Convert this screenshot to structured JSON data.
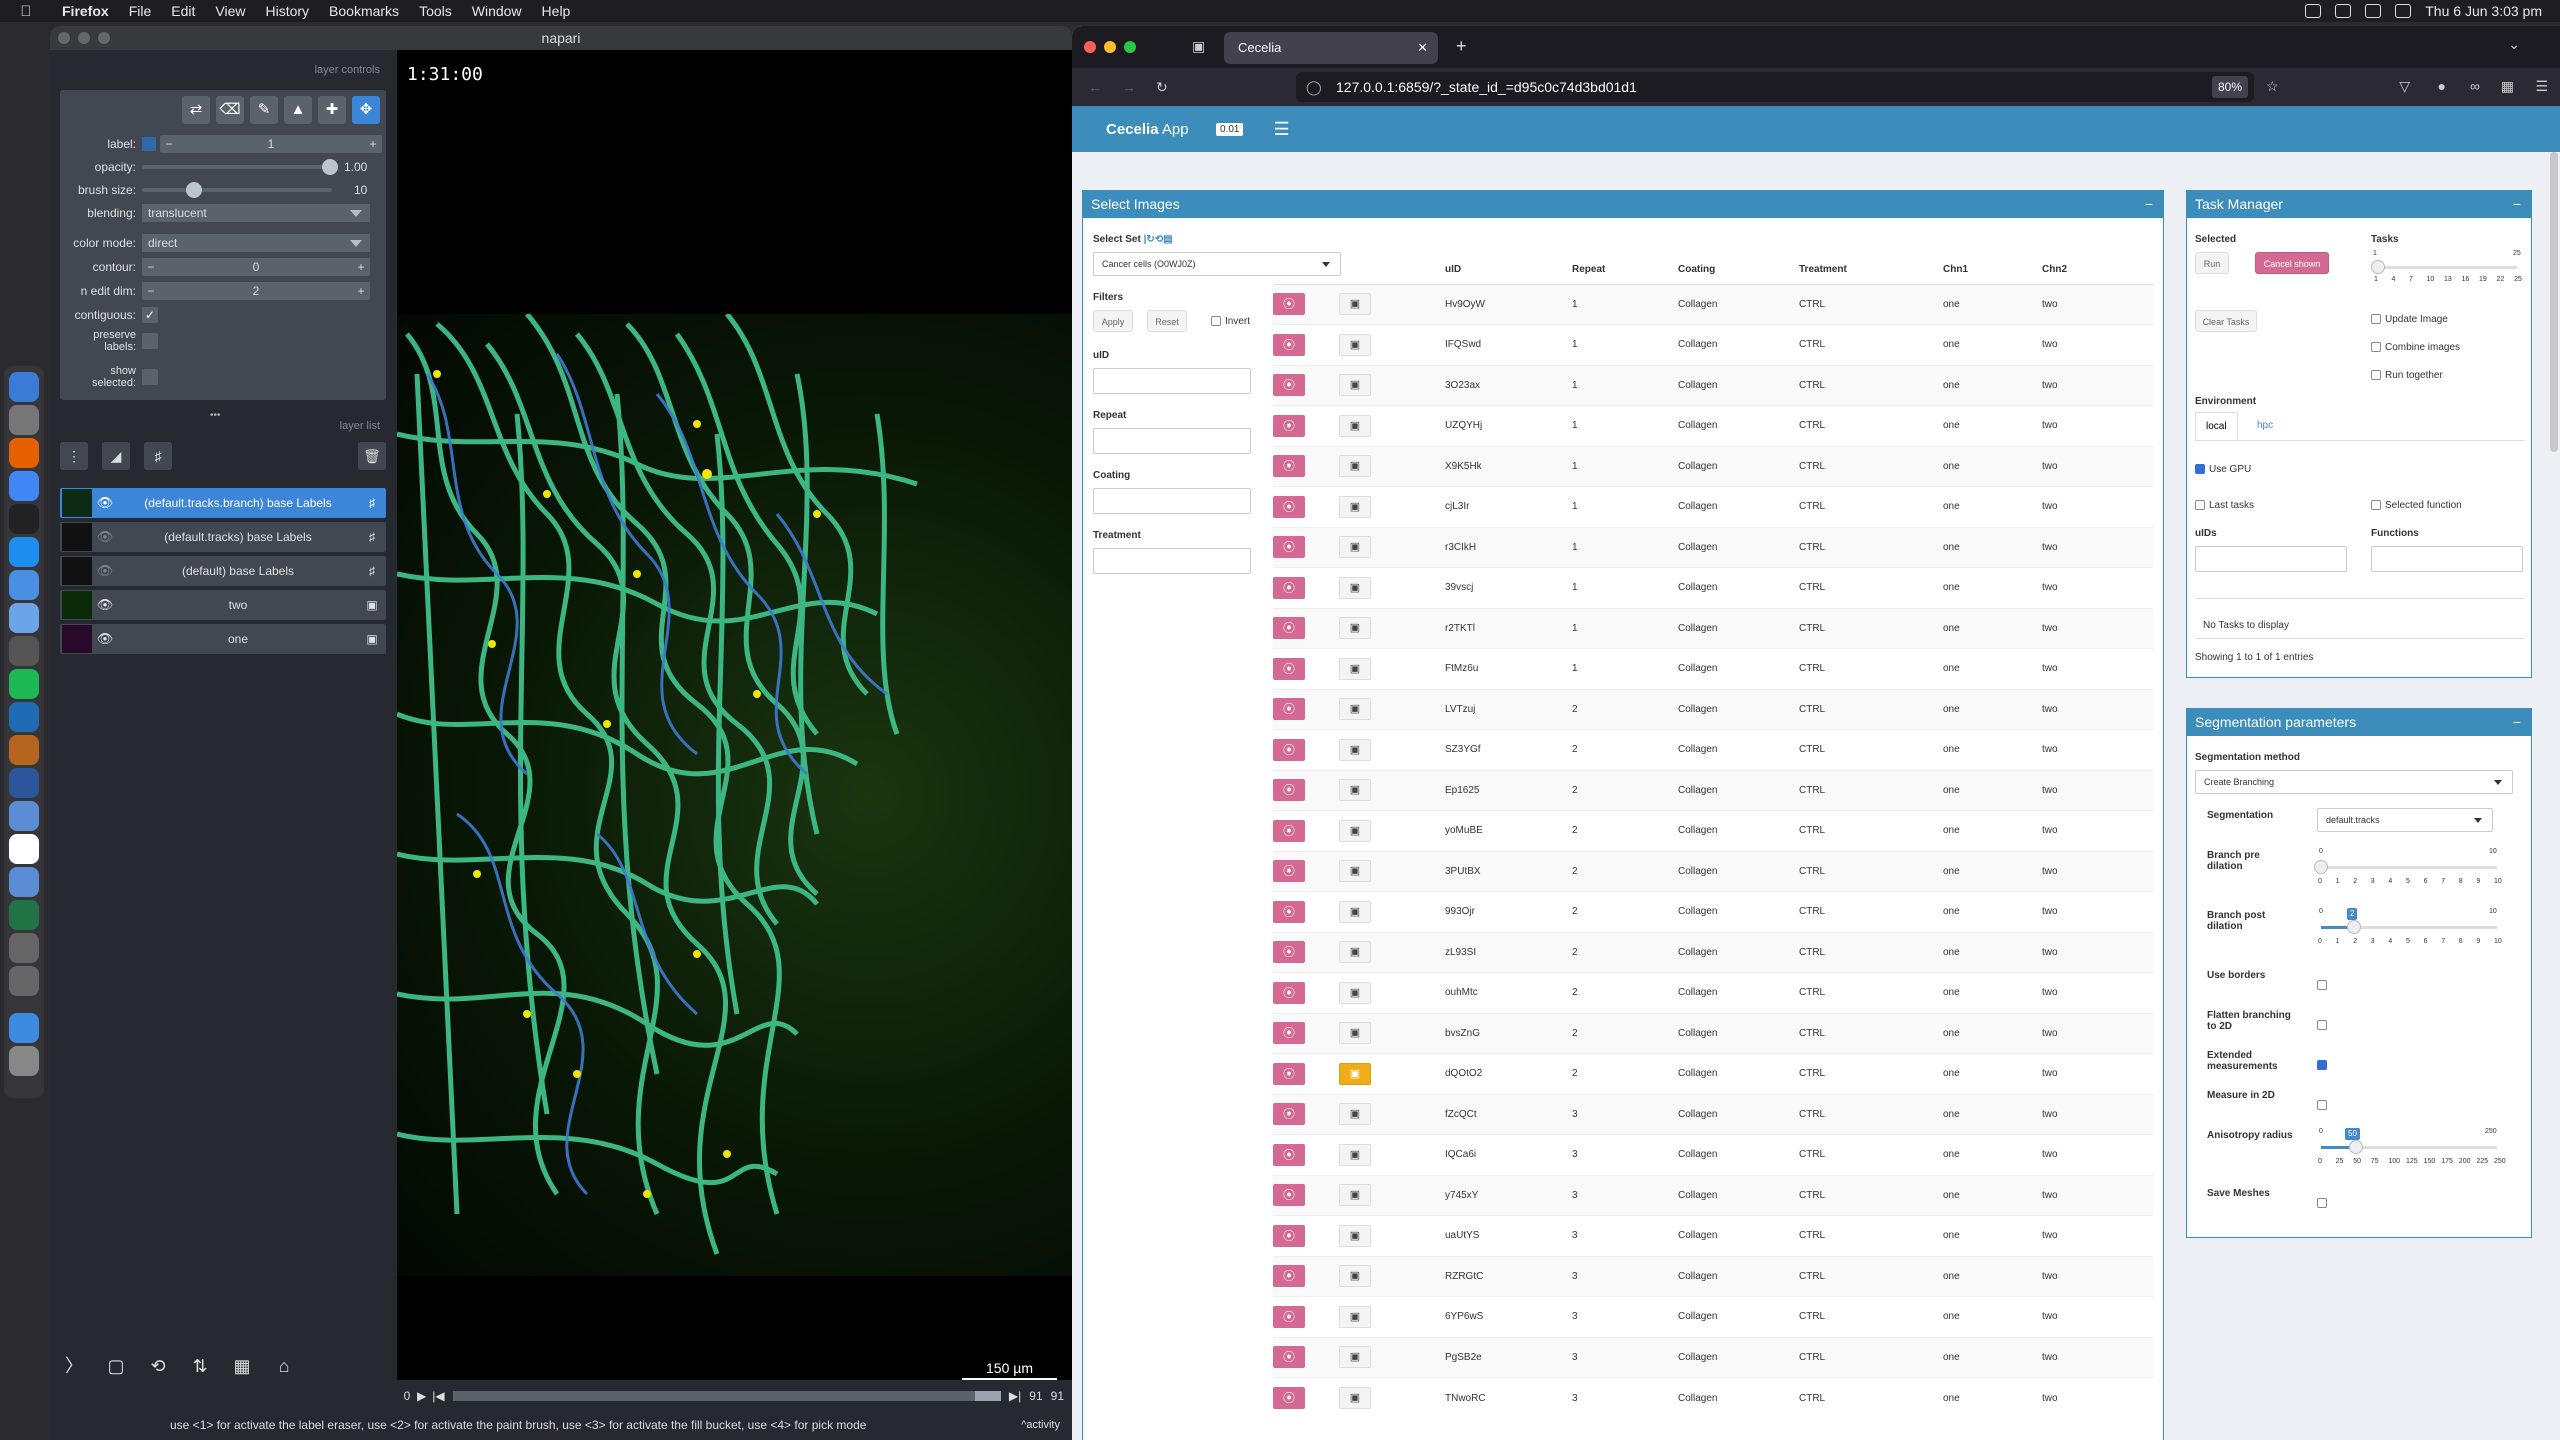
{
  "menubar": {
    "app": "Firefox",
    "items": [
      "File",
      "Edit",
      "View",
      "History",
      "Bookmarks",
      "Tools",
      "Window",
      "Help"
    ],
    "datetime": "Thu 6 Jun  3:03 pm"
  },
  "napari": {
    "title": "napari",
    "layer_controls_title": "layer controls",
    "controls": {
      "label": "label:",
      "label_value": "1",
      "opacity": "opacity:",
      "opacity_value": "1.00",
      "opacity_level": 1.0,
      "brush": "brush size:",
      "brush_value": "10",
      "brush_level": 0.1,
      "blending": "blending:",
      "blending_value": "translucent",
      "color_mode": "color mode:",
      "color_mode_value": "direct",
      "contour": "contour:",
      "contour_value": "0",
      "n_edit": "n edit dim:",
      "n_edit_value": "2",
      "contiguous": "contiguous:",
      "preserve": "preserve labels:",
      "show_selected": "show selected:"
    },
    "layer_list_title": "layer list",
    "layers": [
      {
        "name": "(default.tracks.branch) base Labels",
        "selected": true,
        "type": "labels"
      },
      {
        "name": "(default.tracks) base Labels",
        "selected": false,
        "type": "labels"
      },
      {
        "name": "(default) base Labels",
        "selected": false,
        "type": "labels"
      },
      {
        "name": "two",
        "selected": false,
        "type": "image"
      },
      {
        "name": "one",
        "selected": false,
        "type": "image"
      }
    ],
    "time": "1:31:00",
    "scale": "150 µm",
    "dims": {
      "start": "0",
      "current": "91",
      "max": "91"
    },
    "status": "use <1> for activate the label eraser, use <2> for activate the paint brush, use <3> for activate the fill bucket, use <4> for pick mode",
    "activity": "activity"
  },
  "firefox": {
    "tab_title": "Cecelia",
    "url": "127.0.0.1:6859/?_state_id_=d95c0c74d3bd01d1",
    "zoom": "80%"
  },
  "app": {
    "brand": "Cecelia",
    "brand_suffix": "App",
    "version": "0.01",
    "select_images": {
      "title": "Select Images",
      "select_set_label": "Select Set",
      "set_value": "Cancer cells (O0WJ0Z)",
      "filters": "Filters",
      "apply": "Apply",
      "reset": "Reset",
      "invert": "Invert",
      "filter_fields": [
        "uID",
        "Repeat",
        "Coating",
        "Treatment"
      ],
      "columns": [
        "",
        "",
        "uID",
        "Repeat",
        "Coating",
        "Treatment",
        "Chn1",
        "Chn2"
      ],
      "rows": [
        {
          "uid": "Hv9OyW",
          "repeat": "1"
        },
        {
          "uid": "IFQSwd",
          "repeat": "1"
        },
        {
          "uid": "3O23ax",
          "repeat": "1"
        },
        {
          "uid": "UZQYHj",
          "repeat": "1"
        },
        {
          "uid": "X9K5Hk",
          "repeat": "1"
        },
        {
          "uid": "cjL3Ir",
          "repeat": "1"
        },
        {
          "uid": "r3CIkH",
          "repeat": "1"
        },
        {
          "uid": "39vscj",
          "repeat": "1"
        },
        {
          "uid": "r2TKTl",
          "repeat": "1"
        },
        {
          "uid": "FtMz6u",
          "repeat": "1"
        },
        {
          "uid": "LVTzuj",
          "repeat": "2"
        },
        {
          "uid": "SZ3YGf",
          "repeat": "2"
        },
        {
          "uid": "Ep1625",
          "repeat": "2"
        },
        {
          "uid": "yoMuBE",
          "repeat": "2"
        },
        {
          "uid": "3PUtBX",
          "repeat": "2"
        },
        {
          "uid": "993Ojr",
          "repeat": "2"
        },
        {
          "uid": "zL93SI",
          "repeat": "2"
        },
        {
          "uid": "ouhMtc",
          "repeat": "2"
        },
        {
          "uid": "bvsZnG",
          "repeat": "2"
        },
        {
          "uid": "dQOtO2",
          "repeat": "2",
          "active": true
        },
        {
          "uid": "fZcQCt",
          "repeat": "3"
        },
        {
          "uid": "IQCa6i",
          "repeat": "3"
        },
        {
          "uid": "y745xY",
          "repeat": "3"
        },
        {
          "uid": "uaUtYS",
          "repeat": "3"
        },
        {
          "uid": "RZRGtC",
          "repeat": "3"
        },
        {
          "uid": "6YP6wS",
          "repeat": "3"
        },
        {
          "uid": "PgSB2e",
          "repeat": "3"
        },
        {
          "uid": "TNwoRC",
          "repeat": "3"
        }
      ],
      "coating": "Collagen",
      "treatment": "CTRL",
      "chn1": "one",
      "chn2": "two"
    },
    "task_manager": {
      "title": "Task Manager",
      "selected": "Selected",
      "run": "Run",
      "cancel": "Cancel shown",
      "tasks": "Tasks",
      "tasks_min": "1",
      "tasks_max": "25",
      "tasks_ticks": [
        "1",
        "4",
        "7",
        "10",
        "13",
        "16",
        "19",
        "22",
        "25"
      ],
      "clear": "Clear Tasks",
      "update_image": "Update Image",
      "combine": "Combine images",
      "run_together": "Run together",
      "environment": "Environment",
      "env_tabs": [
        "local",
        "hpc"
      ],
      "use_gpu": "Use GPU",
      "last_tasks": "Last tasks",
      "selected_function": "Selected function",
      "uids": "uIDs",
      "functions": "Functions",
      "no_tasks": "No Tasks to display",
      "showing": "Showing 1 to 1 of 1 entries"
    },
    "segmentation": {
      "title": "Segmentation parameters",
      "method_label": "Segmentation method",
      "method_value": "Create Branching",
      "seg_label": "Segmentation",
      "seg_value": "default.tracks",
      "branch_pre": "Branch pre dilation",
      "branch_pre_min": "0",
      "branch_pre_max": "10",
      "branch_pre_value": "0",
      "branch_post": "Branch post dilation",
      "branch_post_min": "0",
      "branch_post_max": "10",
      "branch_post_value": "2",
      "ticks10": [
        "0",
        "1",
        "2",
        "3",
        "4",
        "5",
        "6",
        "7",
        "8",
        "9",
        "10"
      ],
      "use_borders": "Use borders",
      "flatten": "Flatten branching to 2D",
      "extended": "Extended measurements",
      "measure2d": "Measure in 2D",
      "aniso": "Anisotropy radius",
      "aniso_min": "0",
      "aniso_max": "250",
      "aniso_value": "50",
      "ticks250": [
        "0",
        "25",
        "50",
        "75",
        "100",
        "125",
        "150",
        "175",
        "200",
        "225",
        "250"
      ],
      "save_meshes": "Save Meshes"
    }
  }
}
